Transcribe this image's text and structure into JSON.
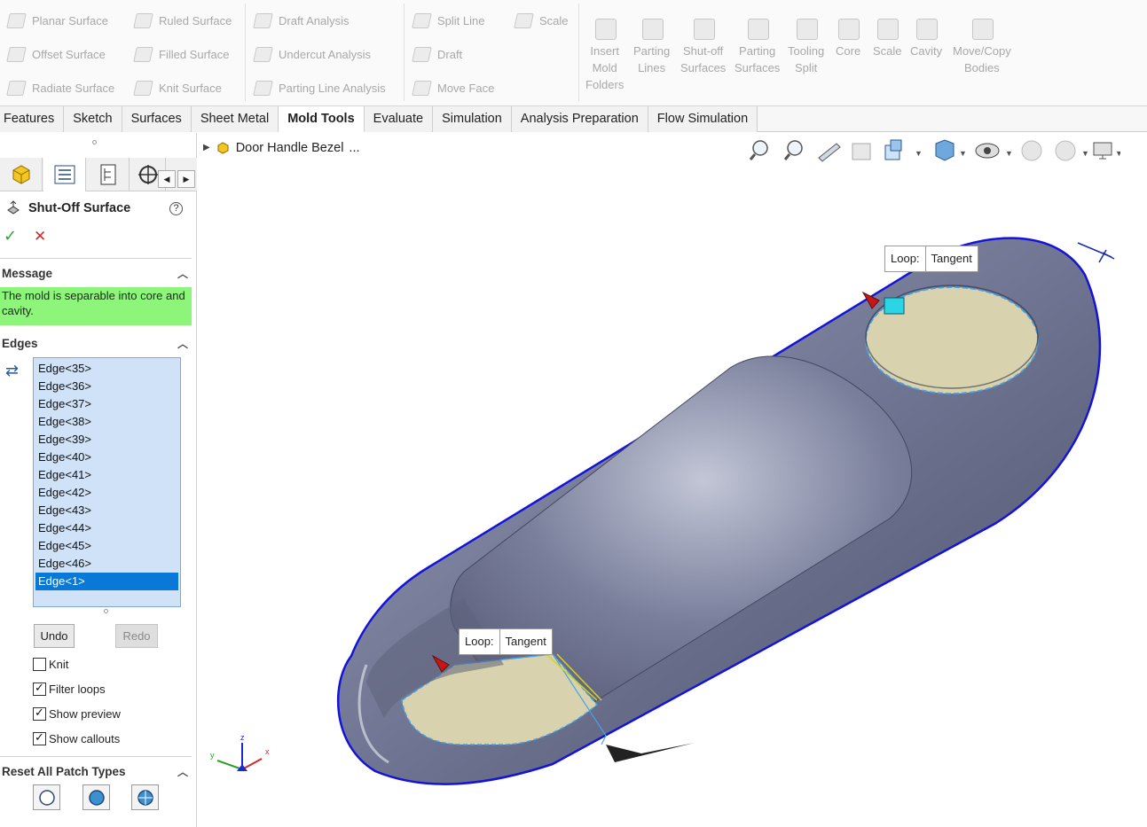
{
  "ribbon": {
    "col1": [
      "Planar Surface",
      "Offset Surface",
      "Radiate Surface"
    ],
    "col2": [
      "Ruled Surface",
      "Filled Surface",
      "Knit Surface"
    ],
    "col3": [
      "Draft Analysis",
      "Undercut Analysis",
      "Parting Line Analysis"
    ],
    "col4": [
      "Split Line",
      "Draft",
      "Move Face"
    ],
    "col5": [
      "Scale"
    ],
    "big": [
      {
        "label": "Insert\nMold\nFolders"
      },
      {
        "label": "Parting\nLines"
      },
      {
        "label": "Shut-off\nSurfaces"
      },
      {
        "label": "Parting\nSurfaces"
      },
      {
        "label": "Tooling\nSplit"
      },
      {
        "label": "Core"
      },
      {
        "label": "Scale"
      },
      {
        "label": "Cavity"
      },
      {
        "label": "Move/Copy\nBodies"
      }
    ]
  },
  "tabs": [
    "Features",
    "Sketch",
    "Surfaces",
    "Sheet Metal",
    "Mold Tools",
    "Evaluate",
    "Simulation",
    "Analysis Preparation",
    "Flow Simulation"
  ],
  "active_tab": "Mold Tools",
  "panel": {
    "title": "Shut-Off Surface",
    "message_header": "Message",
    "message_text": "The mold is separable into core and cavity.",
    "edges_header": "Edges",
    "edges": [
      "Edge<35>",
      "Edge<36>",
      "Edge<37>",
      "Edge<38>",
      "Edge<39>",
      "Edge<40>",
      "Edge<41>",
      "Edge<42>",
      "Edge<43>",
      "Edge<44>",
      "Edge<45>",
      "Edge<46>",
      "Edge<1>"
    ],
    "selected_edge": "Edge<1>",
    "undo_label": "Undo",
    "redo_label": "Redo",
    "checkboxes": [
      {
        "label": "Knit",
        "checked": false
      },
      {
        "label": "Filter loops",
        "checked": true
      },
      {
        "label": "Show preview",
        "checked": true
      },
      {
        "label": "Show callouts",
        "checked": true
      }
    ],
    "patch_header": "Reset All Patch Types"
  },
  "viewport": {
    "breadcrumb": "Door Handle Bezel",
    "breadcrumb_more": "...",
    "callouts": [
      {
        "key": "Loop:",
        "value": "Tangent"
      },
      {
        "key": "Loop:",
        "value": "Tangent"
      }
    ],
    "triad": {
      "x": "x",
      "y": "y",
      "z": "z"
    }
  },
  "colors": {
    "message_bg": "#8ef57b",
    "selected_edge_bg": "#0a78d7",
    "edge_list_bg": "#cfe2f7",
    "part_body": "#7a7f9c",
    "parting_line": "#1414d8",
    "patch_fill": "#d8d3ae"
  }
}
